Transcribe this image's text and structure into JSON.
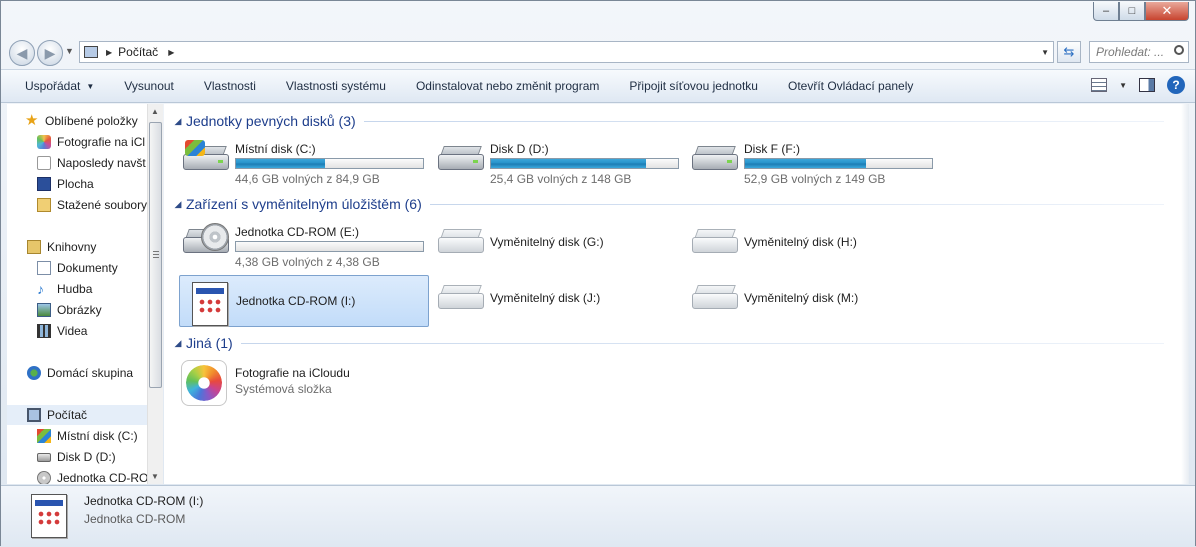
{
  "window": {
    "caption": {
      "minimize": "–",
      "maximize": "□",
      "close": "✕"
    }
  },
  "address": {
    "location": "Počítač",
    "search_placeholder": "Prohledat: ..."
  },
  "toolbar": {
    "items": [
      "Uspořádat",
      "Vysunout",
      "Vlastnosti",
      "Vlastnosti systému",
      "Odinstalovat nebo změnit program",
      "Připojit síťovou jednotku",
      "Otevřít Ovládací panely"
    ],
    "help": "?"
  },
  "navpane": {
    "favorites": "Oblíbené položky",
    "fav_items": [
      "Fotografie na iCl",
      "Naposledy navšt",
      "Plocha",
      "Stažené soubory"
    ],
    "libraries": "Knihovny",
    "lib_items": [
      "Dokumenty",
      "Hudba",
      "Obrázky",
      "Videa"
    ],
    "homegroup": "Domácí skupina",
    "computer": "Počítač",
    "comp_items": [
      "Místní disk (C:)",
      "Disk D (D:)",
      "Jednotka CD-RO"
    ]
  },
  "content": {
    "groups": [
      "Jednotky pevných disků (3)",
      "Zařízení s vyměnitelným úložištěm (6)",
      "Jiná (1)"
    ],
    "hdd": [
      {
        "name": "Místní disk (C:)",
        "free": "44,6 GB volných z 84,9 GB",
        "used_fraction": 0.475
      },
      {
        "name": "Disk D (D:)",
        "free": "25,4 GB volných z 148 GB",
        "used_fraction": 0.83
      },
      {
        "name": "Disk F (F:)",
        "free": "52,9 GB volných z 149 GB",
        "used_fraction": 0.645
      }
    ],
    "removable": [
      {
        "name": "Jednotka CD-ROM (E:)",
        "free": "4,38 GB volných z 4,38 GB",
        "used_fraction": 0.0
      },
      {
        "name": "Vyměnitelný disk (G:)"
      },
      {
        "name": "Vyměnitelný disk (H:)"
      },
      {
        "name": "Jednotka CD-ROM (I:)"
      },
      {
        "name": "Vyměnitelný disk (J:)"
      },
      {
        "name": "Vyměnitelný disk (M:)"
      }
    ],
    "other": [
      {
        "name": "Fotografie na iCloudu",
        "type": "Systémová složka"
      }
    ]
  },
  "details": {
    "name": "Jednotka CD-ROM (I:)",
    "type": "Jednotka CD-ROM"
  },
  "colors": {
    "accent": "#1e3e8c",
    "selection": "#c2dcf9",
    "bar": "#2690c8"
  }
}
